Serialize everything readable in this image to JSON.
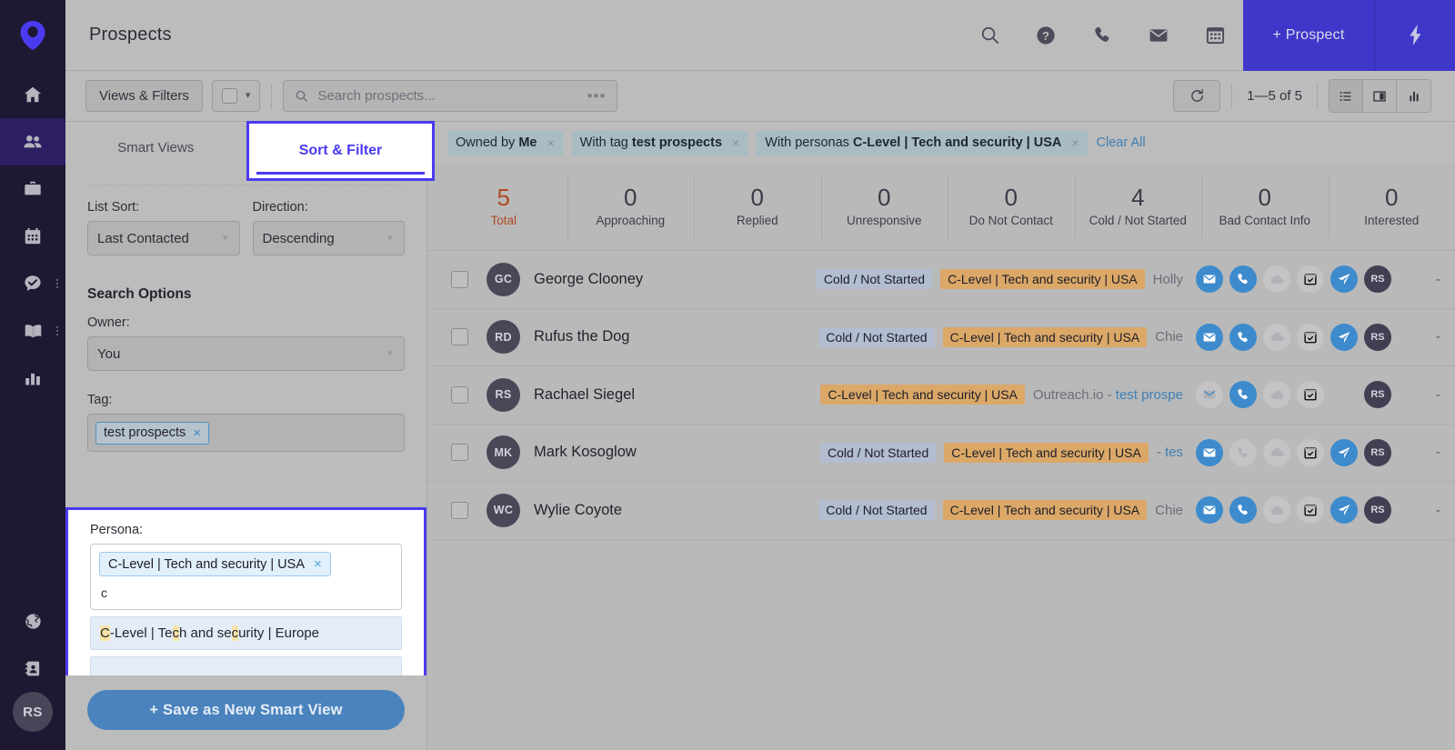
{
  "rail": {
    "logo": "outreach-logo",
    "items": [
      {
        "name": "home",
        "icon": "home-icon",
        "active": false,
        "dots": false
      },
      {
        "name": "prospects",
        "icon": "people-icon",
        "active": true,
        "dots": false
      },
      {
        "name": "accounts",
        "icon": "briefcase-icon",
        "active": false,
        "dots": false
      },
      {
        "name": "calendar",
        "icon": "calendar-icon",
        "active": false,
        "dots": false
      },
      {
        "name": "tasks",
        "icon": "task-check-icon",
        "active": false,
        "dots": true
      },
      {
        "name": "sequences",
        "icon": "book-icon",
        "active": false,
        "dots": true
      },
      {
        "name": "reports",
        "icon": "bar-chart-icon",
        "active": false,
        "dots": false
      }
    ],
    "bottom_items": [
      {
        "name": "globe",
        "icon": "globe-icon"
      },
      {
        "name": "contacts",
        "icon": "contact-card-icon"
      }
    ],
    "avatar_initials": "RS"
  },
  "header": {
    "title": "Prospects",
    "icons": [
      "search-icon",
      "help-icon",
      "phone-icon",
      "mail-icon",
      "calendar-icon"
    ],
    "add_prospect_label": "+ Prospect",
    "bolt_icon": "lightning-bolt-icon"
  },
  "toolbar": {
    "views_filters_label": "Views & Filters",
    "select_all_checkbox": false,
    "search_placeholder": "Search prospects...",
    "overflow": "•••",
    "refresh_icon": "refresh-icon",
    "pager_label": "1—5 of 5",
    "views": [
      {
        "name": "list-view",
        "icon": "list-icon",
        "active": true
      },
      {
        "name": "board-view",
        "icon": "columns-icon",
        "active": false
      },
      {
        "name": "chart-view",
        "icon": "bar-chart-icon",
        "active": false
      }
    ]
  },
  "panel": {
    "tabs": [
      {
        "label": "Smart Views",
        "selected": false
      },
      {
        "label": "Sort & Filter",
        "selected": true
      }
    ],
    "list_sort_label": "List Sort:",
    "list_sort_value": "Last Contacted",
    "direction_label": "Direction:",
    "direction_value": "Descending",
    "search_options_title": "Search Options",
    "owner_label": "Owner:",
    "owner_value": "You",
    "tag_label": "Tag:",
    "tag_chip": "test prospects",
    "persona_label": "Persona:",
    "persona_chip": "C-Level | Tech and security | USA",
    "persona_typed": "c",
    "persona_option_parts": [
      {
        "t": "C",
        "hl": true
      },
      {
        "t": "-Level | Te",
        "hl": false
      },
      {
        "t": "c",
        "hl": true
      },
      {
        "t": "h and se",
        "hl": false
      },
      {
        "t": "c",
        "hl": true
      },
      {
        "t": "urity | Europe",
        "hl": false
      }
    ],
    "persona_option_text": "C-Level | Tech and security | Europe",
    "save_button_label": "+ Save as New Smart View",
    "close_x": "×",
    "chevron": "▾"
  },
  "filters": {
    "chips": [
      {
        "prefix": "Owned by ",
        "value": "Me"
      },
      {
        "prefix": "With tag ",
        "value": "test prospects"
      },
      {
        "prefix": "With personas ",
        "value": "C-Level | Tech and security | USA"
      }
    ],
    "clear_all_label": "Clear All",
    "chip_close": "×"
  },
  "stats": [
    {
      "num": "5",
      "label": "Total",
      "highlight": true
    },
    {
      "num": "0",
      "label": "Approaching",
      "highlight": false
    },
    {
      "num": "0",
      "label": "Replied",
      "highlight": false
    },
    {
      "num": "0",
      "label": "Unresponsive",
      "highlight": false
    },
    {
      "num": "0",
      "label": "Do Not Contact",
      "highlight": false
    },
    {
      "num": "4",
      "label": "Cold / Not Started",
      "highlight": false
    },
    {
      "num": "0",
      "label": "Bad Contact Info",
      "highlight": false
    },
    {
      "num": "0",
      "label": "Interested",
      "highlight": false
    }
  ],
  "rows": [
    {
      "initials": "GC",
      "name": "George Clooney",
      "stage": "Cold / Not Started",
      "persona": "C-Level | Tech and security | USA",
      "meta": "Holly",
      "meta_link": "",
      "actions": [
        "mail-on",
        "phone-on",
        "cloud-off",
        "calendar-off",
        "send-on",
        "owner"
      ],
      "last": "-"
    },
    {
      "initials": "RD",
      "name": "Rufus the Dog",
      "stage": "Cold / Not Started",
      "persona": "C-Level | Tech and security | USA",
      "meta": "Chie",
      "meta_link": "",
      "actions": [
        "mail-on",
        "phone-on",
        "cloud-off",
        "calendar-off",
        "send-on",
        "owner"
      ],
      "last": "-"
    },
    {
      "initials": "RS",
      "name": "Rachael Siegel",
      "stage": "",
      "persona": "C-Level | Tech and security | USA",
      "meta": "Outreach.io - ",
      "meta_link": "test prospe",
      "actions": [
        "mail-off",
        "phone-on",
        "cloud-off",
        "calendar-off",
        "send-plain",
        "owner"
      ],
      "last": "-"
    },
    {
      "initials": "MK",
      "name": "Mark Kosoglow",
      "stage": "Cold / Not Started",
      "persona": "C-Level | Tech and security | USA",
      "meta": "- ",
      "meta_link": "tes",
      "actions": [
        "mail-on",
        "phone-off",
        "cloud-off",
        "calendar-off",
        "send-on",
        "owner"
      ],
      "last": "-"
    },
    {
      "initials": "WC",
      "name": "Wylie Coyote",
      "stage": "Cold / Not Started",
      "persona": "C-Level | Tech and security | USA",
      "meta": "Chie",
      "meta_link": "",
      "actions": [
        "mail-on",
        "phone-on",
        "cloud-off",
        "calendar-off",
        "send-on",
        "owner"
      ],
      "last": "-"
    }
  ],
  "owner_initials": "RS",
  "colors": {
    "accent_purple": "#3f37c9",
    "highlight_blue": "#4b3bf0",
    "persona_tag": "#dba868",
    "stage_tag": "#b3bdd0",
    "total_red": "#b04a22",
    "action_blue": "#3d8bcd",
    "save_blue": "#4a83bd",
    "rail_dark": "#1e1833"
  }
}
